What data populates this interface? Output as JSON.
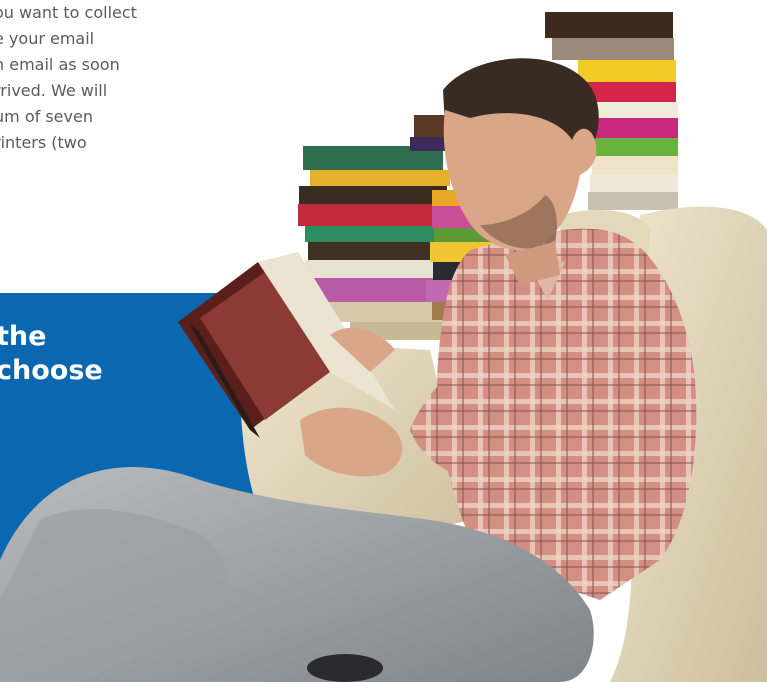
{
  "body_copy": {
    "lines": [
      "ou want to collect",
      "e your email",
      "n email as soon",
      "rrived. We will",
      "um of seven",
      "rinters (two"
    ]
  },
  "panel": {
    "heading_lines": [
      "the",
      "choose"
    ],
    "color": "#0b67b0"
  },
  "photo": {
    "subject": "man-reading-book-on-sofa",
    "props": [
      "book-stacks",
      "open-book",
      "sofa"
    ]
  }
}
